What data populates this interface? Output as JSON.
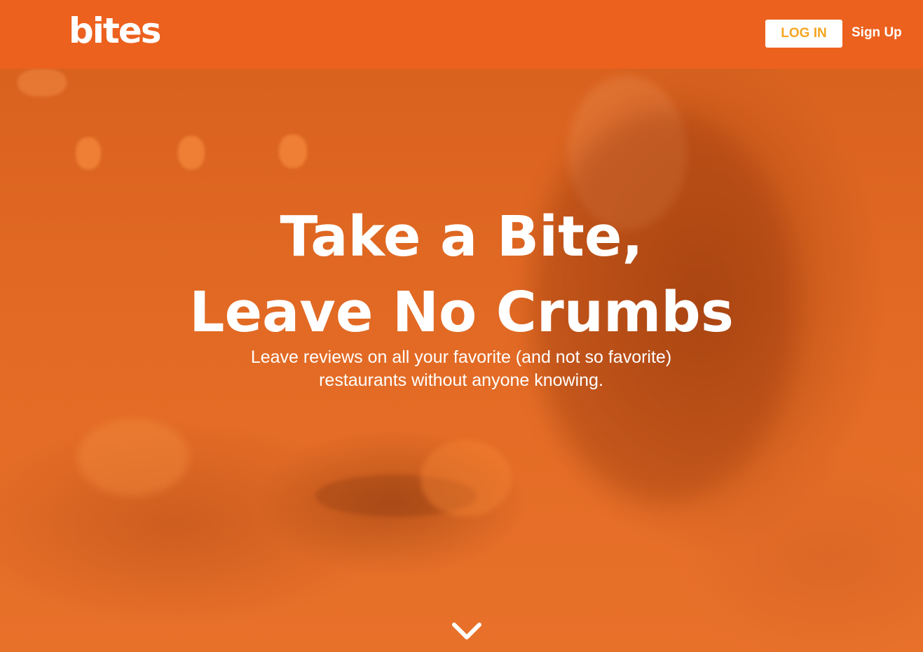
{
  "header": {
    "logo_text": "bites",
    "login_label": "LOG IN",
    "signup_label": "Sign Up"
  },
  "hero": {
    "headline_line1": "Take a Bite,",
    "headline_line2": "Leave No Crumbs",
    "subtitle_line1": "Leave reviews on all your favorite (and not so favorite)",
    "subtitle_line2": "restaurants without anyone knowing.",
    "scroll_icon": "chevron-down-icon"
  },
  "colors": {
    "brand_orange": "#ec611e",
    "login_text": "#f5a623",
    "text": "#ffffff"
  }
}
